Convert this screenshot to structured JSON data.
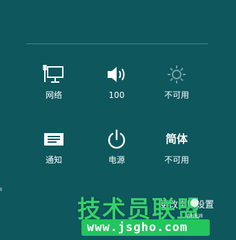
{
  "settings_panel": {
    "tiles": [
      {
        "label": "网络",
        "icon": "network-icon",
        "state": "enabled"
      },
      {
        "label": "100",
        "icon": "speaker-volume-icon",
        "state": "enabled"
      },
      {
        "label": "不可用",
        "icon": "brightness-icon",
        "state": "disabled"
      },
      {
        "label": "通知",
        "icon": "notifications-icon",
        "state": "enabled"
      },
      {
        "label": "电源",
        "icon": "power-icon",
        "state": "enabled"
      },
      {
        "label": "不可用",
        "icon": "language-icon",
        "state": "disabled",
        "icon_text": "简体"
      }
    ],
    "keyboard_text": "更改电脑设置"
  },
  "watermark": {
    "title": "技术员联盟",
    "url": "www.jsgho.com",
    "small_text": "农村在线"
  },
  "colors": {
    "background": "#0d575d",
    "watermark_green": "#36d16a",
    "url_bar_green": "#22c55e",
    "text": "#ffffff"
  }
}
